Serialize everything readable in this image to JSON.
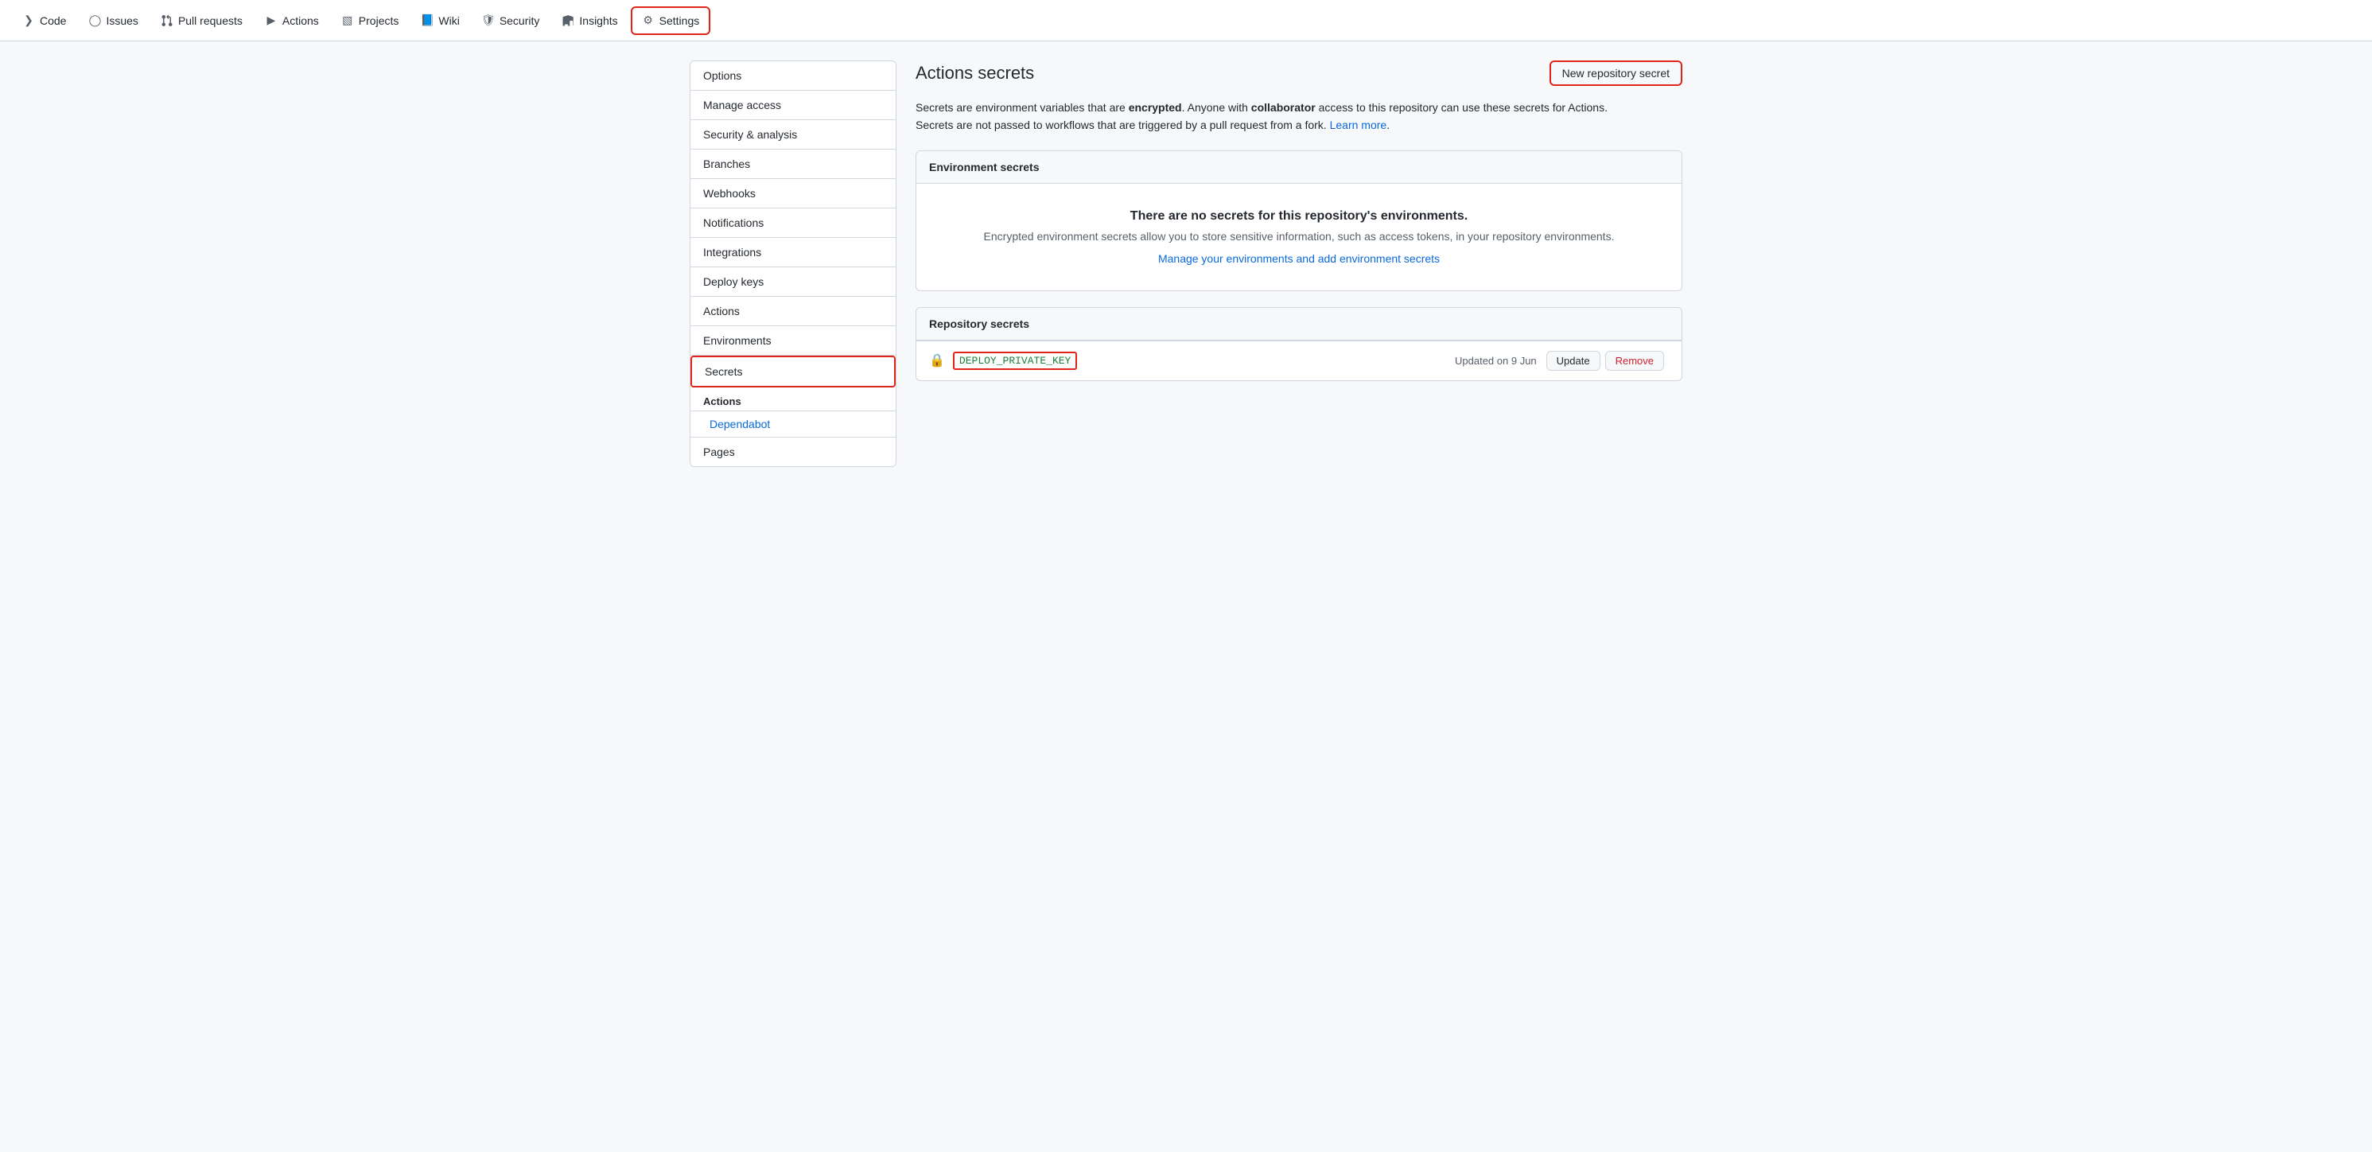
{
  "nav": {
    "items": [
      {
        "label": "Code",
        "icon": "code-icon",
        "active": false
      },
      {
        "label": "Issues",
        "icon": "issues-icon",
        "active": false
      },
      {
        "label": "Pull requests",
        "icon": "pr-icon",
        "active": false
      },
      {
        "label": "Actions",
        "icon": "actions-icon",
        "active": false
      },
      {
        "label": "Projects",
        "icon": "projects-icon",
        "active": false
      },
      {
        "label": "Wiki",
        "icon": "wiki-icon",
        "active": false
      },
      {
        "label": "Security",
        "icon": "security-icon",
        "active": false
      },
      {
        "label": "Insights",
        "icon": "insights-icon",
        "active": false
      },
      {
        "label": "Settings",
        "icon": "settings-icon",
        "active": true
      }
    ]
  },
  "sidebar": {
    "items": [
      {
        "label": "Options",
        "active": false
      },
      {
        "label": "Manage access",
        "active": false
      },
      {
        "label": "Security & analysis",
        "active": false
      },
      {
        "label": "Branches",
        "active": false
      },
      {
        "label": "Webhooks",
        "active": false
      },
      {
        "label": "Notifications",
        "active": false
      },
      {
        "label": "Integrations",
        "active": false
      },
      {
        "label": "Deploy keys",
        "active": false
      },
      {
        "label": "Actions",
        "active": false
      },
      {
        "label": "Environments",
        "active": false
      },
      {
        "label": "Secrets",
        "active": true
      }
    ],
    "sub_header": "Actions",
    "sub_item": "Dependabot",
    "pages_label": "Pages"
  },
  "main": {
    "page_title": "Actions secrets",
    "new_secret_btn": "New repository secret",
    "description_line1_start": "Secrets are environment variables that are ",
    "description_bold1": "encrypted",
    "description_line1_mid": ". Anyone with ",
    "description_bold2": "collaborator",
    "description_line1_end": " access to this repository can use these secrets for Actions.",
    "description_line2_start": "Secrets are not passed to workflows that are triggered by a pull request from a fork. ",
    "description_link": "Learn more",
    "description_line2_end": ".",
    "env_secrets": {
      "header": "Environment secrets",
      "empty_title": "There are no secrets for this repository's environments.",
      "empty_desc": "Encrypted environment secrets allow you to store sensitive information, such as access tokens, in your repository environments.",
      "manage_link": "Manage your environments and add environment secrets"
    },
    "repo_secrets": {
      "header": "Repository secrets",
      "items": [
        {
          "name": "DEPLOY_PRIVATE_KEY",
          "updated": "Updated on 9 Jun",
          "update_btn": "Update",
          "remove_btn": "Remove"
        }
      ]
    }
  }
}
